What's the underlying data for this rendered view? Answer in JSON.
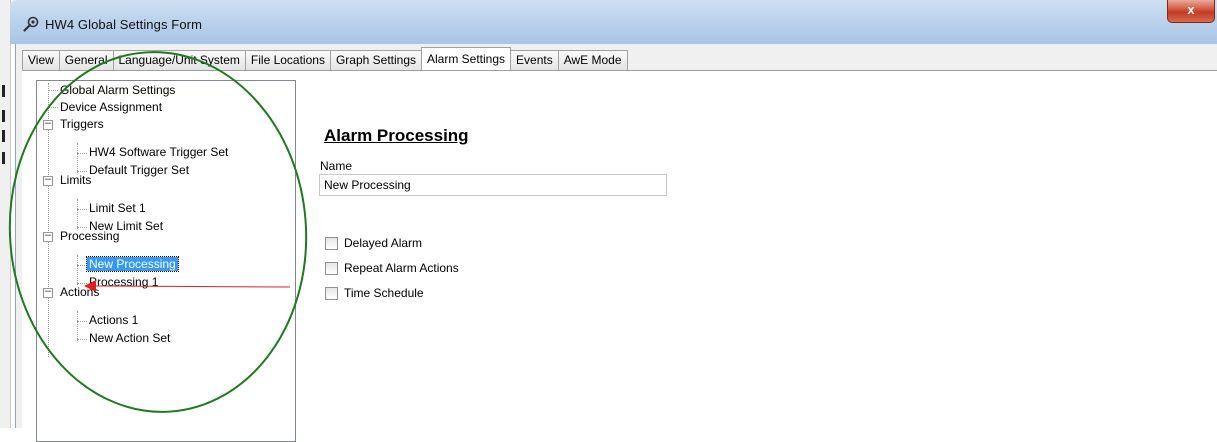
{
  "window": {
    "title": "HW4 Global Settings Form",
    "close_glyph": "x",
    "title_icon": "wrench-icon"
  },
  "tabs": [
    {
      "label": "View",
      "active": false
    },
    {
      "label": "General",
      "active": false
    },
    {
      "label": "Language/Unit System",
      "active": false
    },
    {
      "label": "File Locations",
      "active": false
    },
    {
      "label": "Graph Settings",
      "active": false
    },
    {
      "label": "Alarm Settings",
      "active": true
    },
    {
      "label": "Events",
      "active": false
    },
    {
      "label": "AwE Mode",
      "active": false
    }
  ],
  "tree": {
    "global_alarm_settings": "Global Alarm Settings",
    "device_assignment": "Device Assignment",
    "triggers": "Triggers",
    "hw4_software_trigger_set": "HW4 Software Trigger Set",
    "default_trigger_set": "Default Trigger Set",
    "limits": "Limits",
    "limit_set_1": "Limit Set 1",
    "new_limit_set": "New Limit Set",
    "processing": "Processing",
    "new_processing": "New Processing",
    "processing_1": "Processing 1",
    "actions": "Actions",
    "actions_1": "Actions 1",
    "new_action_set": "New Action Set",
    "expander_glyph": "−"
  },
  "detail": {
    "heading": "Alarm Processing",
    "name_label": "Name",
    "name_value": "New Processing",
    "checkboxes": [
      {
        "label": "Delayed Alarm",
        "checked": false
      },
      {
        "label": "Repeat Alarm Actions",
        "checked": false
      },
      {
        "label": "Time Schedule",
        "checked": false
      }
    ]
  },
  "colors": {
    "selection": "#3399ff",
    "annotation_ellipse": "#1f7a1f",
    "annotation_arrow": "#e02020",
    "close_button": "#c43a20"
  }
}
